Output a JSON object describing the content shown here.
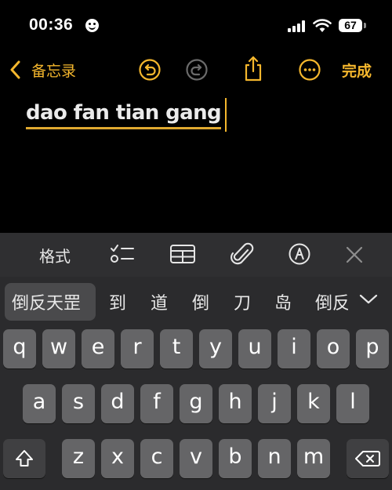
{
  "status_bar": {
    "time": "00:36",
    "battery": "67"
  },
  "nav": {
    "back_label": "备忘录",
    "done_label": "完成"
  },
  "note": {
    "title": "dao fan tian gang"
  },
  "toolbar": {
    "format_label": "格式"
  },
  "candidates": [
    "倒反天罡",
    "到",
    "道",
    "倒",
    "刀",
    "岛",
    "倒反"
  ],
  "keyboard": {
    "row1": [
      "q",
      "w",
      "e",
      "r",
      "t",
      "y",
      "u",
      "i",
      "o",
      "p"
    ],
    "row2": [
      "a",
      "s",
      "d",
      "f",
      "g",
      "h",
      "j",
      "k",
      "l"
    ],
    "row3": [
      "z",
      "x",
      "c",
      "v",
      "b",
      "n",
      "m"
    ]
  },
  "colors": {
    "accent": "#f5b72d",
    "background": "#000000",
    "key": "#656567",
    "key_dark": "#404042"
  }
}
